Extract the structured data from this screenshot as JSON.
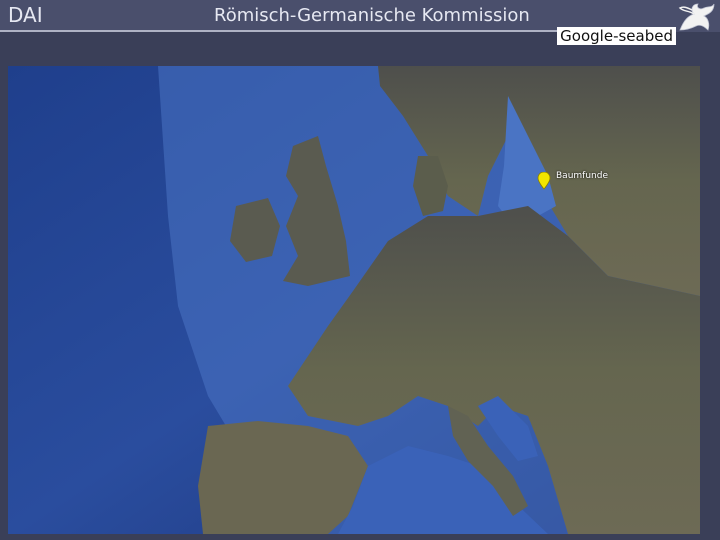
{
  "header": {
    "org_abbrev": "DAI",
    "commission": "Römisch-Germanische Kommission"
  },
  "map": {
    "layer_caption": "Google-seabed",
    "marker": {
      "label": "Baumfunde",
      "color": "#f2e600"
    }
  },
  "colors": {
    "header_bg": "#4a4f6c",
    "ocean": "#2c4fa8",
    "land": "#5a5c52"
  }
}
